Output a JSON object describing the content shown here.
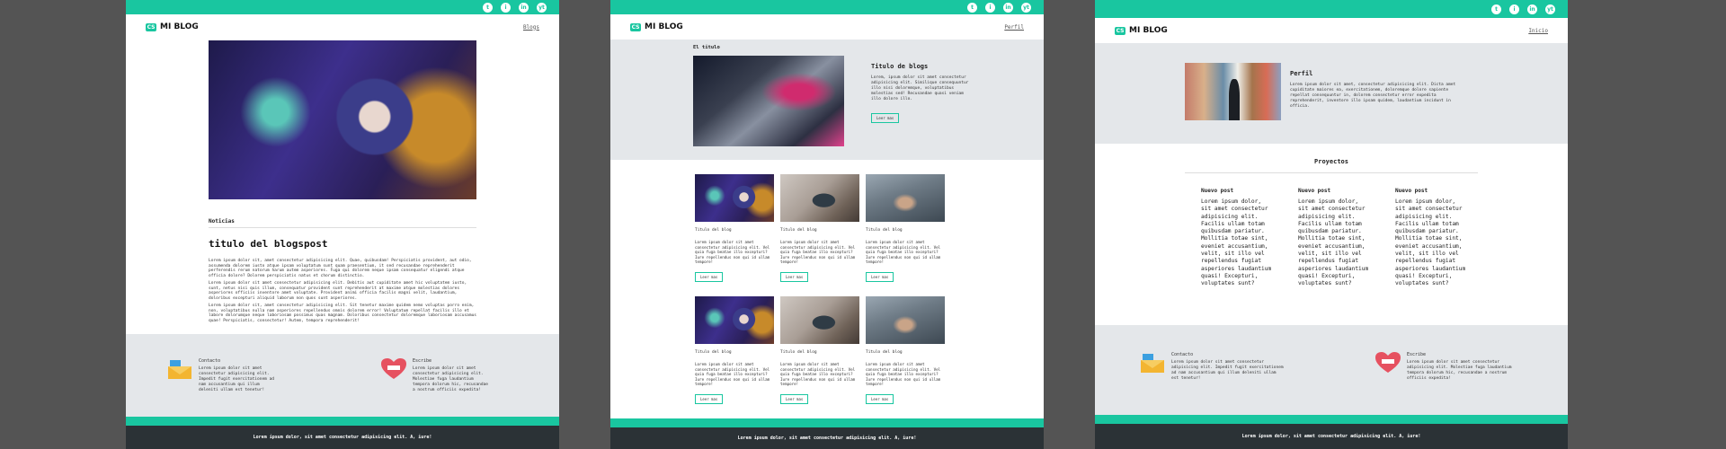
{
  "social": [
    "t",
    "i",
    "in",
    "yt"
  ],
  "brand": {
    "name": "MI BLOG",
    "mark": "CS"
  },
  "page1": {
    "nav": "Blogs",
    "section": "Noticias",
    "title": "titulo del blogspost",
    "paragraphs": [
      "Lorem ipsum dolor sit, amet consectetur adipisicing elit. Quae, quibusdam! Perspiciatis provident, aut odio, assumenda dolorem iusto atque ipsam voluptatum sunt quam praesentium, it sed recusandae reprehenderit perferendis rerum natorum harum autem asperiores. Fuga qui dolorem neque ipsam consequatur eligendi atque officia dolore? Dolorem perspiciatis natus et chorum distinctio.",
      "Lorem ipsum dolor sit amet consectetur adipisicing elit. Debitis aut cupiditate amet hic voluptatem iusto, sunt, netus nisi quis illum, consequatur provident sunt reprehenderit at maxime atque molestias dolores asperiores officiis inventore amet voluptate. Provident animi officia facilis magni velit, laudantium, doloribus excepturi aliquid laborum non quos sunt asperiores.",
      "Lorem ipsum dolor sit, amet consectetur adipisicing elit. Sit tenetur maxime quidem nemo voluptas porro enim, non, voluptatibus nulla nam asperiores repellendus omnis dolorem error! Voluptatum repellat facilis illo et labore dolorumque neque laboriosam possimus quas magnam. Doloribus consectetur doloremque laboriosam accusamus quae! Perspiciatis, consectetur! Autem, tempora reprehenderit!"
    ]
  },
  "page2": {
    "nav": "Perfil",
    "section": "El titulo",
    "hero_title": "Titulo de blogs",
    "hero_text": "Lorem, ipsum dolor sit amet consectetur adipisicing elit. Similique consequuntur illo nisi doloremque, voluptatibus molestias sed! Recusandae quasi veniam illo dolore illo.",
    "button": "Leer mas",
    "card_title": "Titulo del blog",
    "card_text": "Lorem ipsum dolor sit amet consectetur adipisicing elit. Vel quia fuga beatae illo excepturi? Iure repellendus non qui id ullam tempore!"
  },
  "page3": {
    "nav": "Inicio",
    "profile_title": "Perfil",
    "profile_text": "Lorem ipsum dolor sit amet, consectetur adipisicing elit. Dicta amet cupiditate maiores ea, exercitationem, doloremque dolore sapiente repellat consequuntur in, dolorem consectetur error expedita reprehenderit, inventore illo ipsam quidem, laudantium incidunt in officia.",
    "projects_title": "Proyectos",
    "project_title": "Nuevo post",
    "project_text": "Lorem ipsum dolor, sit amet consectetur adipisicing elit. Facilis ullam totam quibusdam pariatur. Mollitia totae sint, eveniet accusantium, velit, sit illo vel repellendus fugiat asperiores laudantium quasi! Excepturi, voluptates sunt?"
  },
  "footer": {
    "contact_title": "Contacto",
    "contact_text": "Lorem ipsum dolor sit amet consectetur adipisicing elit. Impedit fugit exercitationem ad nam accusantium qui illum deleniti ullam est tenetur!",
    "write_title": "Escribe",
    "write_text": "Lorem ipsum dolor sit amet consectetur adipisicing elit. Molestiae fuga laudantium tempora dolorum hic, recusandae a nostrum officiis expedita!",
    "bottom": "Lorem ipsum dolor, sit amet consectetur adipisicing elit. A, iure!"
  }
}
